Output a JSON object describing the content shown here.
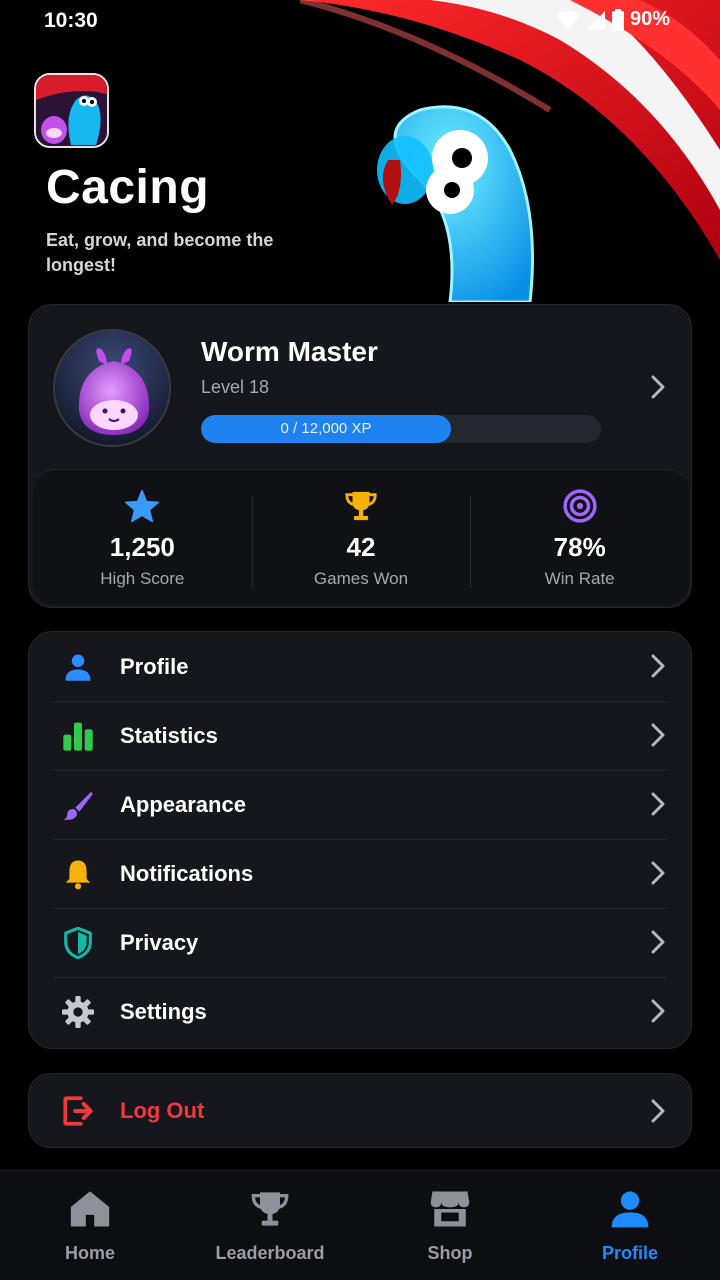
{
  "status_bar": {
    "time": "10:30",
    "battery": "90%"
  },
  "hero": {
    "app_name": "Cacing",
    "tagline": "Eat, grow, and become the longest!"
  },
  "profile": {
    "username": "Worm Master",
    "level": "Level 18",
    "xp_text": "0 / 12,000 XP",
    "xp_progress": 0.625
  },
  "stats": [
    {
      "icon": "star-icon",
      "value": "1,250",
      "label": "High Score",
      "color": "#3a9bff"
    },
    {
      "icon": "trophy-icon",
      "value": "42",
      "label": "Games Won",
      "color": "#f6b10b"
    },
    {
      "icon": "target-icon",
      "value": "78%",
      "label": "Win Rate",
      "color": "#a064ff"
    }
  ],
  "menu": [
    {
      "icon": "user-icon",
      "label": "Profile",
      "color": "#2d8cff"
    },
    {
      "icon": "bar-chart-icon",
      "label": "Statistics",
      "color": "#2fcb4f"
    },
    {
      "icon": "brush-icon",
      "label": "Appearance",
      "color": "#a064ff"
    },
    {
      "icon": "bell-icon",
      "label": "Notifications",
      "color": "#f6b10b"
    },
    {
      "icon": "shield-icon",
      "label": "Privacy",
      "color": "#14b8a6"
    },
    {
      "icon": "gear-icon",
      "label": "Settings",
      "color": "#c7c9cf"
    }
  ],
  "logout": {
    "label": "Log Out",
    "color": "#f0393d"
  },
  "nav": [
    {
      "icon": "home-icon",
      "label": "Home",
      "active": false
    },
    {
      "icon": "trophy-icon",
      "label": "Leaderboard",
      "active": false
    },
    {
      "icon": "store-icon",
      "label": "Shop",
      "active": false
    },
    {
      "icon": "user-icon",
      "label": "Profile",
      "active": true
    }
  ],
  "colors": {
    "accent": "#1e82f0",
    "danger": "#f0393d",
    "card": "#15171c"
  }
}
